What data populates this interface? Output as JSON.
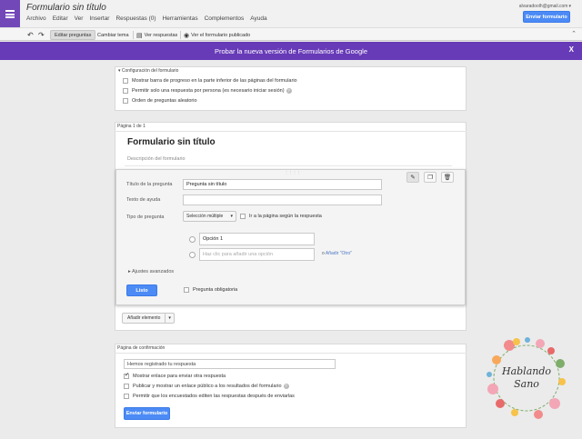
{
  "header": {
    "doc_title": "Formulario sin título",
    "menu": [
      "Archivo",
      "Editar",
      "Ver",
      "Insertar",
      "Respuestas (0)",
      "Herramientas",
      "Complementos",
      "Ayuda"
    ],
    "email": "alvaradoolh@gmail.com",
    "send_button": "Enviar formulario"
  },
  "toolbar": {
    "edit_questions": "Editar preguntas",
    "change_theme": "Cambiar tema",
    "view_responses": "Ver respuestas",
    "view_published": "Ver el formulario publicado"
  },
  "banner": {
    "text": "Probar la nueva versión de Formularios de Google",
    "close": "X"
  },
  "settings": {
    "title": "Configuración del formulario",
    "options": [
      {
        "label": "Mostrar barra de progreso en la parte inferior de las páginas del formulario",
        "checked": false
      },
      {
        "label": "Permitir solo una respuesta por persona (es necesario iniciar sesión)",
        "checked": false,
        "help": "?"
      },
      {
        "label": "Orden de preguntas aleatorio",
        "checked": false
      }
    ]
  },
  "page": {
    "label": "Página 1 de 1",
    "form_title": "Formulario sin título",
    "form_description_placeholder": "Descripción del formulario"
  },
  "question": {
    "title_label": "Título de la pregunta",
    "title_value": "Pregunta sin título",
    "help_label": "Texto de ayuda",
    "type_label": "Tipo de pregunta",
    "type_value": "Selección múltiple",
    "go_to_page_label": "Ir a la página según la respuesta",
    "option1": "Opción 1",
    "add_option_placeholder": "Haz clic para añadir una opción",
    "or_text": "o",
    "add_other": "Añadir \"Otro\"",
    "advanced": "Ajustes avanzados",
    "done_button": "Listo",
    "required_label": "Pregunta obligatoria"
  },
  "add_element": {
    "label": "Añadir elemento"
  },
  "confirmation": {
    "label": "Página de confirmación",
    "message": "Hemos registrado tu respuesta",
    "options": [
      {
        "label": "Mostrar enlace para enviar otra respuesta",
        "checked": true
      },
      {
        "label": "Publicar y mostrar un enlace público a los resultados del formulario",
        "checked": false,
        "help": "?"
      },
      {
        "label": "Permitir que los encuestados editen las respuestas después de enviarlas",
        "checked": false
      }
    ],
    "send_button": "Enviar formulario"
  },
  "watermark": {
    "line1": "Hablando",
    "line2": "Sano"
  },
  "colors": {
    "accent_purple": "#673ab7",
    "button_blue": "#4c8bf5"
  }
}
